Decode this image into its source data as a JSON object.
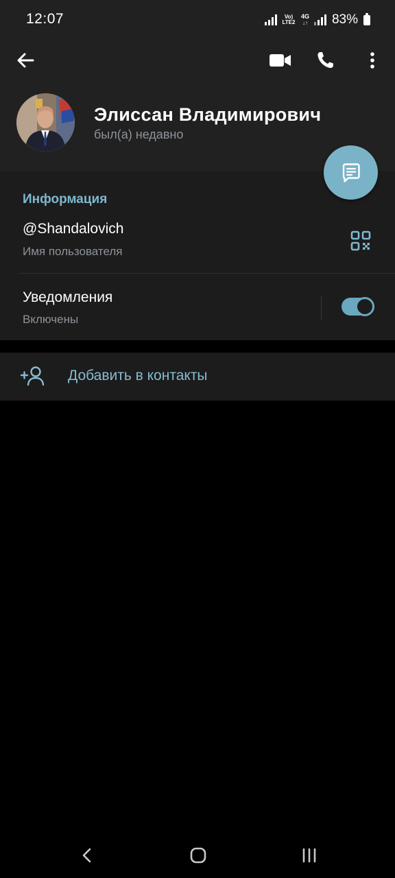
{
  "status_bar": {
    "time": "12:07",
    "volte_top": "Vo)",
    "volte_bottom": "LTE2",
    "network_type": "4G",
    "battery_percent": "83%"
  },
  "header": {
    "contact_name": "Элиссан Владимирович",
    "last_seen": "был(а) недавно",
    "icons": [
      "back-arrow-icon",
      "video-camera-icon",
      "phone-icon",
      "more-vertical-icon"
    ]
  },
  "fab": {
    "icon": "message-icon"
  },
  "info": {
    "section_title": "Информация",
    "username": "@Shandalovich",
    "username_caption": "Имя пользователя",
    "notifications_label": "Уведомления",
    "notifications_status": "Включены",
    "notifications_enabled": true
  },
  "actions": {
    "add_contact_label": "Добавить в контакты"
  },
  "colors": {
    "accent": "#7fb8cf",
    "fab": "#7ab3c7",
    "surface": "#1c1c1c",
    "header": "#212121"
  }
}
